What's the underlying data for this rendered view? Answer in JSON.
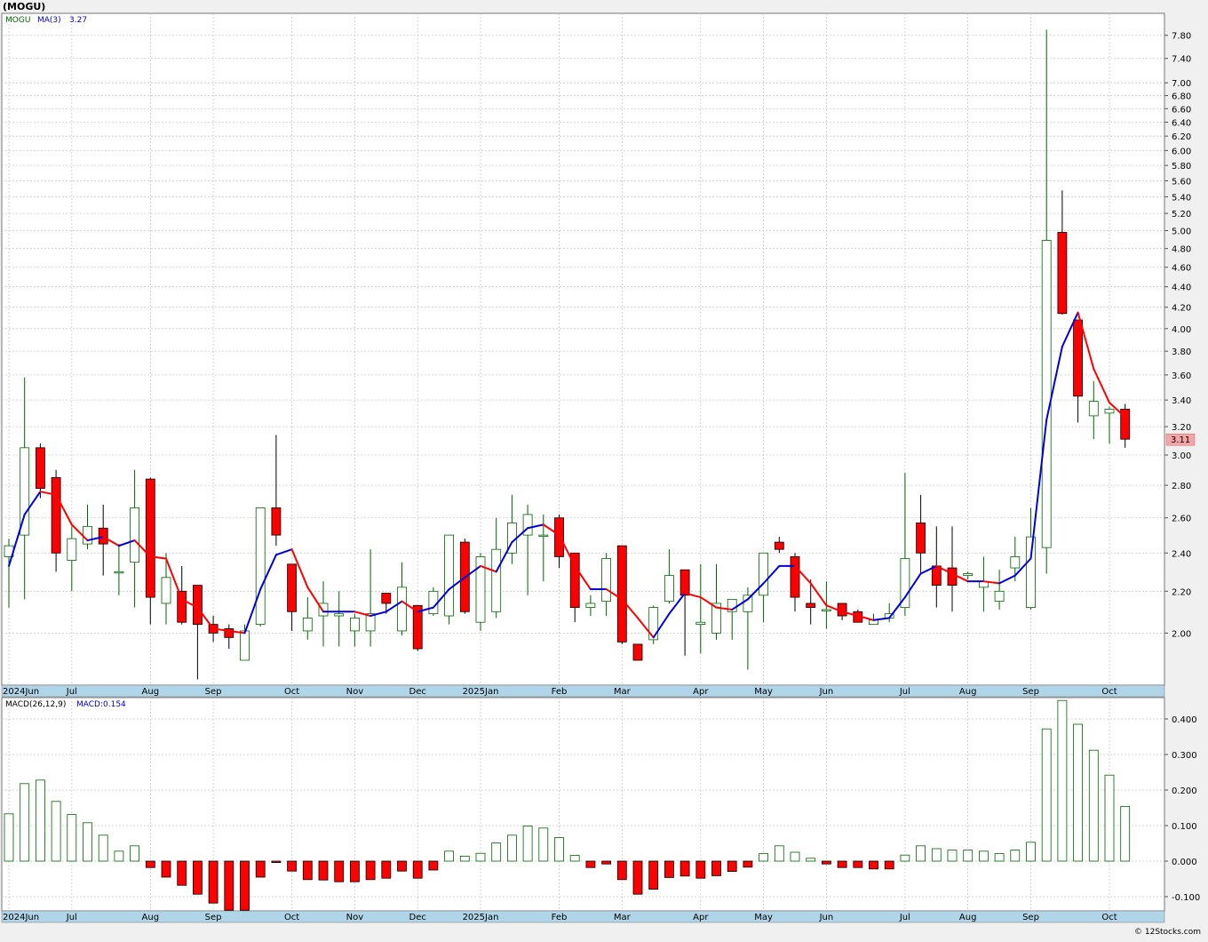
{
  "header": {
    "symbol_title": "(MOGU)"
  },
  "legend": {
    "symbol": "MOGU",
    "ma_label": "MA(3)",
    "ma_value": "3.27",
    "macd_label": "MACD(26,12,9)",
    "macd_value_label": "MACD:0.154"
  },
  "last_price_badge": "3.11",
  "footer": {
    "credit": "© 12Stocks.com"
  },
  "colors": {
    "up_candle_fill": "#ffffff",
    "up_candle_stroke": "#006400",
    "down_candle_fill": "#ff0000",
    "ma_up": "#0000dd",
    "ma_down": "#ff0000",
    "axis_strip": "#b0d4e8",
    "price_badge": "#f4a6a6"
  },
  "chart_data": [
    {
      "type": "candlestick",
      "title": "(MOGU)",
      "y_ticks": [
        "2.00",
        "2.20",
        "2.40",
        "2.60",
        "2.80",
        "3.00",
        "3.20",
        "3.40",
        "3.60",
        "3.80",
        "4.00",
        "4.20",
        "4.40",
        "4.60",
        "4.80",
        "5.00",
        "5.20",
        "5.40",
        "5.60",
        "5.80",
        "6.00",
        "6.20",
        "6.40",
        "6.60",
        "6.80",
        "7.00",
        "7.40",
        "7.80"
      ],
      "y_scale": "log",
      "ylim": [
        1.78,
        8.2
      ],
      "x_tick_labels": [
        "2024Jun",
        "Jul",
        "Aug",
        "Sep",
        "Oct",
        "Nov",
        "Dec",
        "2025Jan",
        "Feb",
        "Mar",
        "Apr",
        "May",
        "Jun",
        "Jul",
        "Aug",
        "Sep",
        "Oct"
      ],
      "x_tick_weeks": [
        0,
        4,
        9,
        13,
        18,
        22,
        26,
        30,
        35,
        39,
        44,
        48,
        52,
        57,
        61,
        65,
        70
      ],
      "grid": true,
      "series": [
        {
          "ohlc": [
            [
              2.38,
              2.48,
              2.12,
              2.44
            ],
            [
              2.5,
              3.58,
              2.16,
              3.05
            ],
            [
              3.05,
              3.08,
              2.72,
              2.78
            ],
            [
              2.85,
              2.9,
              2.3,
              2.4
            ],
            [
              2.36,
              2.55,
              2.2,
              2.48
            ],
            [
              2.45,
              2.68,
              2.42,
              2.55
            ],
            [
              2.54,
              2.68,
              2.28,
              2.45
            ],
            [
              2.3,
              2.45,
              2.18,
              2.3
            ],
            [
              2.35,
              2.9,
              2.12,
              2.66
            ],
            [
              2.84,
              2.85,
              2.04,
              2.17
            ],
            [
              2.14,
              2.4,
              2.04,
              2.27
            ],
            [
              2.2,
              2.33,
              2.04,
              2.05
            ],
            [
              2.23,
              2.23,
              1.8,
              2.04
            ],
            [
              2.04,
              2.08,
              1.96,
              2.0
            ],
            [
              2.02,
              2.04,
              1.93,
              1.98
            ],
            [
              1.88,
              2.04,
              1.88,
              2.01
            ],
            [
              2.04,
              2.66,
              2.03,
              2.66
            ],
            [
              2.66,
              3.14,
              2.44,
              2.5
            ],
            [
              2.34,
              2.34,
              2.01,
              2.1
            ],
            [
              2.01,
              2.17,
              1.97,
              2.07
            ],
            [
              2.08,
              2.25,
              1.94,
              2.14
            ],
            [
              2.08,
              2.2,
              1.94,
              2.09
            ],
            [
              2.01,
              2.09,
              1.94,
              2.07
            ],
            [
              2.01,
              2.42,
              1.94,
              2.09
            ],
            [
              2.19,
              2.19,
              2.09,
              2.14
            ],
            [
              2.01,
              2.35,
              1.99,
              2.22
            ],
            [
              2.13,
              2.13,
              1.92,
              1.93
            ],
            [
              2.09,
              2.22,
              2.08,
              2.2
            ],
            [
              2.08,
              2.5,
              2.04,
              2.5
            ],
            [
              2.46,
              2.48,
              2.09,
              2.1
            ],
            [
              2.05,
              2.4,
              2.01,
              2.38
            ],
            [
              2.1,
              2.6,
              2.07,
              2.42
            ],
            [
              2.4,
              2.74,
              2.34,
              2.57
            ],
            [
              2.5,
              2.68,
              2.18,
              2.62
            ],
            [
              2.5,
              2.62,
              2.25,
              2.5
            ],
            [
              2.6,
              2.62,
              2.32,
              2.38
            ],
            [
              2.4,
              2.4,
              2.05,
              2.12
            ],
            [
              2.12,
              2.18,
              2.08,
              2.14
            ],
            [
              2.15,
              2.4,
              2.08,
              2.37
            ],
            [
              2.44,
              2.44,
              1.95,
              1.96
            ],
            [
              1.95,
              1.95,
              1.88,
              1.88
            ],
            [
              1.97,
              2.13,
              1.95,
              2.12
            ],
            [
              2.15,
              2.42,
              2.14,
              2.28
            ],
            [
              2.31,
              2.31,
              1.9,
              2.18
            ],
            [
              2.04,
              2.34,
              1.91,
              2.05
            ],
            [
              2.0,
              2.34,
              1.97,
              2.14
            ],
            [
              2.1,
              2.15,
              1.97,
              2.16
            ],
            [
              2.1,
              2.22,
              1.84,
              2.18
            ],
            [
              2.18,
              2.4,
              2.05,
              2.4
            ],
            [
              2.46,
              2.49,
              2.4,
              2.42
            ],
            [
              2.38,
              2.4,
              2.1,
              2.17
            ],
            [
              2.14,
              2.26,
              2.04,
              2.12
            ],
            [
              2.11,
              2.25,
              2.02,
              2.11
            ],
            [
              2.14,
              2.14,
              2.06,
              2.08
            ],
            [
              2.1,
              2.11,
              2.05,
              2.05
            ],
            [
              2.04,
              2.09,
              2.04,
              2.06
            ],
            [
              2.07,
              2.14,
              2.05,
              2.09
            ],
            [
              2.12,
              2.88,
              2.08,
              2.37
            ],
            [
              2.57,
              2.74,
              2.29,
              2.4
            ],
            [
              2.33,
              2.55,
              2.12,
              2.23
            ],
            [
              2.32,
              2.55,
              2.1,
              2.23
            ],
            [
              2.28,
              2.3,
              2.26,
              2.29
            ],
            [
              2.22,
              2.38,
              2.1,
              2.25
            ],
            [
              2.15,
              2.31,
              2.11,
              2.2
            ],
            [
              2.32,
              2.49,
              2.25,
              2.38
            ],
            [
              2.12,
              2.66,
              2.11,
              2.49
            ],
            [
              2.43,
              7.9,
              2.29,
              4.89
            ],
            [
              4.98,
              5.48,
              4.13,
              4.14
            ],
            [
              4.08,
              4.08,
              3.23,
              3.43
            ],
            [
              3.28,
              3.55,
              3.11,
              3.39
            ],
            [
              3.3,
              3.35,
              3.08,
              3.33
            ],
            [
              3.33,
              3.37,
              3.05,
              3.11
            ]
          ]
        },
        {
          "name": "MA(3)",
          "values": [
            2.33,
            2.62,
            2.76,
            2.74,
            2.56,
            2.47,
            2.49,
            2.44,
            2.47,
            2.38,
            2.37,
            2.16,
            2.12,
            2.02,
            2.01,
            2.0,
            2.21,
            2.39,
            2.42,
            2.22,
            2.1,
            2.1,
            2.1,
            2.08,
            2.1,
            2.15,
            2.1,
            2.12,
            2.21,
            2.27,
            2.33,
            2.3,
            2.46,
            2.54,
            2.56,
            2.5,
            2.33,
            2.21,
            2.21,
            2.16,
            2.07,
            1.98,
            2.09,
            2.19,
            2.17,
            2.12,
            2.11,
            2.16,
            2.24,
            2.33,
            2.33,
            2.24,
            2.13,
            2.1,
            2.08,
            2.06,
            2.07,
            2.17,
            2.29,
            2.33,
            2.29,
            2.25,
            2.25,
            2.24,
            2.28,
            2.37,
            3.25,
            3.84,
            4.15,
            3.65,
            3.38,
            3.27
          ]
        }
      ],
      "last_value": "3.11"
    },
    {
      "type": "bar",
      "title": "MACD(26,12,9)",
      "y_ticks": [
        "-0.100",
        "0.000",
        "0.100",
        "0.200",
        "0.300",
        "0.400"
      ],
      "ylim": [
        -0.14,
        0.46
      ],
      "series": [
        {
          "name": "MACD",
          "values": [
            0.133,
            0.218,
            0.228,
            0.168,
            0.131,
            0.108,
            0.073,
            0.028,
            0.043,
            -0.018,
            -0.045,
            -0.068,
            -0.093,
            -0.118,
            -0.138,
            -0.138,
            -0.045,
            -0.004,
            -0.028,
            -0.052,
            -0.053,
            -0.058,
            -0.058,
            -0.052,
            -0.048,
            -0.028,
            -0.048,
            -0.025,
            0.028,
            0.014,
            0.022,
            0.051,
            0.073,
            0.099,
            0.093,
            0.066,
            0.016,
            -0.018,
            -0.008,
            -0.052,
            -0.093,
            -0.079,
            -0.046,
            -0.042,
            -0.048,
            -0.041,
            -0.029,
            -0.017,
            0.021,
            0.043,
            0.025,
            0.008,
            -0.008,
            -0.018,
            -0.018,
            -0.022,
            -0.022,
            0.017,
            0.043,
            0.035,
            0.031,
            0.031,
            0.028,
            0.021,
            0.031,
            0.053,
            0.372,
            0.452,
            0.385,
            0.312,
            0.242,
            0.154
          ]
        }
      ]
    }
  ]
}
